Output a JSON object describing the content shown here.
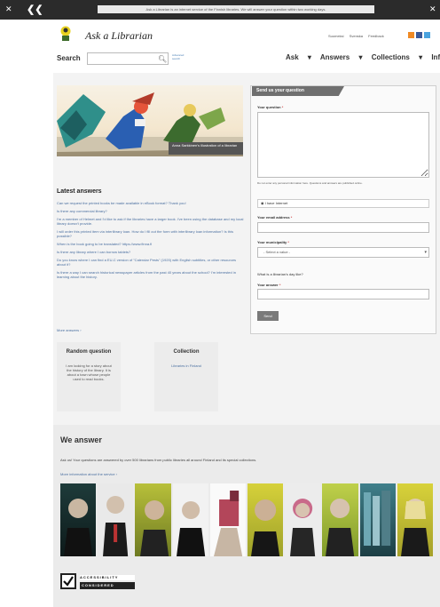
{
  "topbar": {
    "notice": "Ask a Librarian is an internet service of the Finnish libraries. We will answer your question within two working days."
  },
  "header": {
    "title": "Ask a Librarian",
    "toplinks": [
      "Suomeksi",
      "Svenska",
      "Feedback"
    ],
    "search": {
      "label": "Search",
      "placeholder": "",
      "advanced": "Advanced search"
    },
    "nav": [
      "Ask",
      "Answers",
      "Collections",
      "Info"
    ]
  },
  "hero": {
    "caption": "Anna Sarkkinen's illustration of a librarian"
  },
  "latest": {
    "heading": "Latest answers",
    "items": [
      "Can we request the printed books be made available in eBook format? Thank you!",
      "Is there any commercial library?",
      "I'm a member of Helmet and I'd like to ask if the libraries have a larger book. I've been using the database and my local library doesn't provide.",
      "I will order this printed item via interlibrary loan. How do I fill out the form with interlibrary loan information? Is this possible?",
      "When is the book going to be translated? https://www.finna.fi",
      "Is there any library where I can borrow tablets?",
      "Do you know where I can find a EU-C version of \"Calendar Pests\" (1920) with English subtitles, or other resources about it?",
      "Is there a way I can search historical newspaper articles from the past 40 years about the school? I'm interested in learning about the history."
    ],
    "more": "More answers"
  },
  "random_question": {
    "title": "Random question",
    "text": "I am looking for a story about the history of the library. It is about a town whose people used to read books."
  },
  "collection": {
    "title": "Collection",
    "link": "Libraries in Finland"
  },
  "form": {
    "heading": "Send us your question",
    "question_label": "Your question",
    "note": "Do not enter any personal information here. Questions and answers are published online.",
    "radio_label": "I have Internet",
    "email_label": "Your email address",
    "municipality_label": "Your municipality",
    "select_value": "- Select a value -",
    "check_label": "What is a librarian's day like?",
    "answer_label": "Your answer",
    "send": "Send"
  },
  "we_answer": {
    "title": "We answer",
    "text": "Ask us! Your questions are answered by over 500 librarians from public libraries all around Finland and its special collections.",
    "more": "More information about the service"
  },
  "accessibility": {
    "line1": "ACCESSIBILITY",
    "line2": "CONSIDERED"
  },
  "colors": {
    "topbar": "#2b2b2b",
    "link": "#4a6fa0",
    "required": "#cc3333",
    "panel_head": "#6f6f6f"
  }
}
